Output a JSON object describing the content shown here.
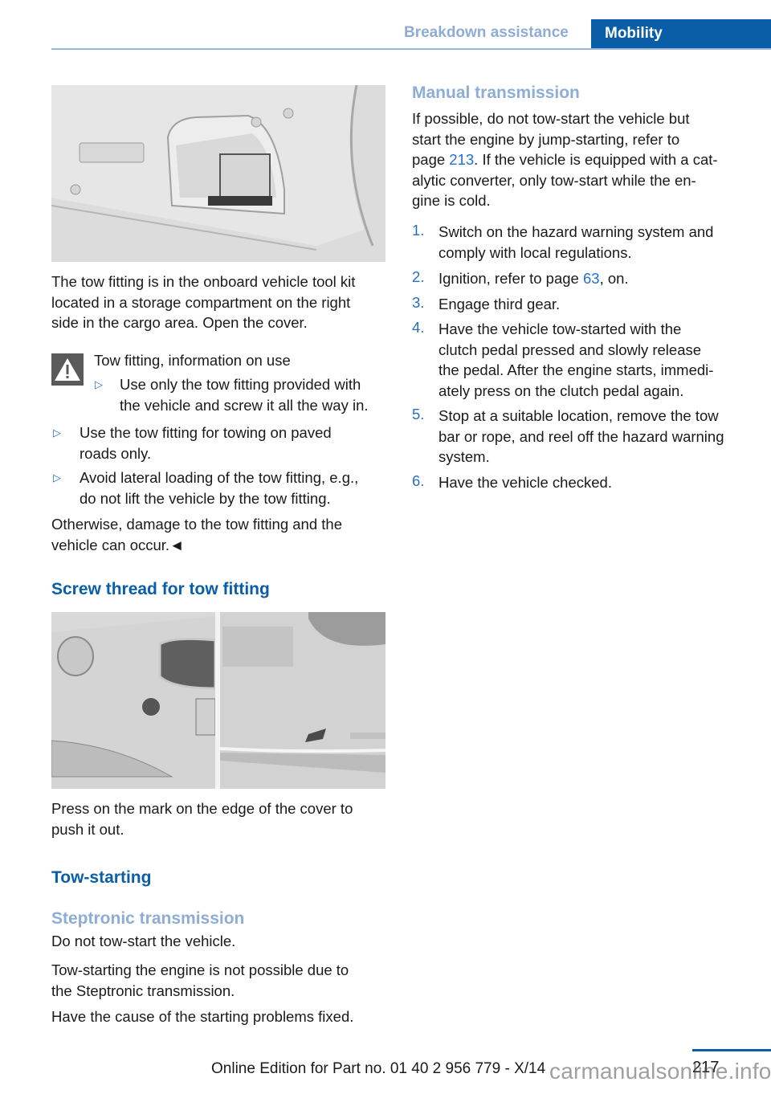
{
  "header": {
    "section": "Breakdown assistance",
    "chapter": "Mobility"
  },
  "left": {
    "figure1_alt": "Storage compartment with tool kit on right side of cargo area",
    "para1": [
      "The tow fitting is in the onboard vehicle tool kit",
      "located in a storage compartment on the right",
      "side in the cargo area. Open the cover."
    ],
    "warning": {
      "title": "Tow fitting, information on use",
      "items": [
        [
          "Use only the tow fitting provided with",
          "the vehicle and screw it all the way in."
        ],
        [
          "Use the tow fitting for towing on paved",
          "roads only."
        ],
        [
          "Avoid lateral loading of the tow fitting, e.g.,",
          "do not lift the vehicle by the tow fitting."
        ]
      ],
      "closing": [
        "Otherwise, damage to the tow fitting and the",
        "vehicle can occur.◄"
      ]
    },
    "heading_screw": "Screw thread for tow fitting",
    "figure2_alt": "Front and rear bumper covers for tow fitting thread",
    "para2": [
      "Press on the mark on the edge of the cover to",
      "push it out."
    ],
    "heading_tow": "Tow-starting",
    "heading_steptronic": "Steptronic transmission",
    "steptronic_p1": "Do not tow-start the vehicle.",
    "steptronic_p2": [
      "Tow-starting the engine is not possible due to",
      "the Steptronic transmission."
    ],
    "steptronic_p3": "Have the cause of the starting problems fixed."
  },
  "right": {
    "heading_manual": "Manual transmission",
    "intro": {
      "l1": "If possible, do not tow-start the vehicle but",
      "l2": "start the engine by jump-starting, refer to",
      "l3_pre": "page ",
      "l3_link": "213",
      "l3_post": ". If the vehicle is equipped with a cat-",
      "l4": "alytic converter, only tow-start while the en-",
      "l5": "gine is cold."
    },
    "steps": [
      {
        "num": "1.",
        "lines": [
          "Switch on the hazard warning system and",
          "comply with local regulations."
        ]
      },
      {
        "num": "2.",
        "pre": "Ignition, refer to page ",
        "link": "63",
        "post": ", on."
      },
      {
        "num": "3.",
        "lines": [
          "Engage third gear."
        ]
      },
      {
        "num": "4.",
        "lines": [
          "Have the vehicle tow-started with the",
          "clutch pedal pressed and slowly release",
          "the pedal. After the engine starts, immedi-",
          "ately press on the clutch pedal again."
        ]
      },
      {
        "num": "5.",
        "lines": [
          "Stop at a suitable location, remove the tow",
          "bar or rope, and reel off the hazard warning",
          "system."
        ]
      },
      {
        "num": "6.",
        "lines": [
          "Have the vehicle checked."
        ]
      }
    ]
  },
  "footer": {
    "edition": "Online Edition for Part no. 01 40 2 956 779 - X/14",
    "page": "217",
    "watermark": "carmanualsonline.info"
  }
}
